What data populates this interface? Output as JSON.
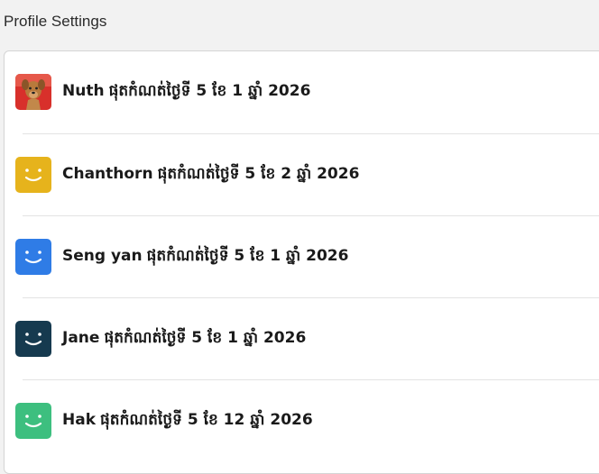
{
  "header": {
    "title": "Profile Settings"
  },
  "profiles": [
    {
      "name": "Nuth",
      "expiry": "ផុតកំណត់ថ្ងៃទី 5 ខែ 1 ឆ្នាំ 2026",
      "avatar": "dog",
      "color": "#d8302b"
    },
    {
      "name": "Chanthorn",
      "expiry": "ផុតកំណត់ថ្ងៃទី 5 ខែ 2 ឆ្នាំ 2026",
      "avatar": "smiley-icon",
      "color": "#e6b31c"
    },
    {
      "name": "Seng yan",
      "expiry": "ផុតកំណត់ថ្ងៃទី 5 ខែ 1 ឆ្នាំ 2026",
      "avatar": "smiley-icon",
      "color": "#2f7ce6"
    },
    {
      "name": "Jane",
      "expiry": "ផុតកំណត់ថ្ងៃទី 5 ខែ 1 ឆ្នាំ 2026",
      "avatar": "smiley-icon",
      "color": "#163a4f"
    },
    {
      "name": "Hak",
      "expiry": "ផុតកំណត់ថ្ងៃទី 5 ខែ 12 ឆ្នាំ 2026",
      "avatar": "smiley-icon",
      "color": "#3dbf7f"
    }
  ]
}
